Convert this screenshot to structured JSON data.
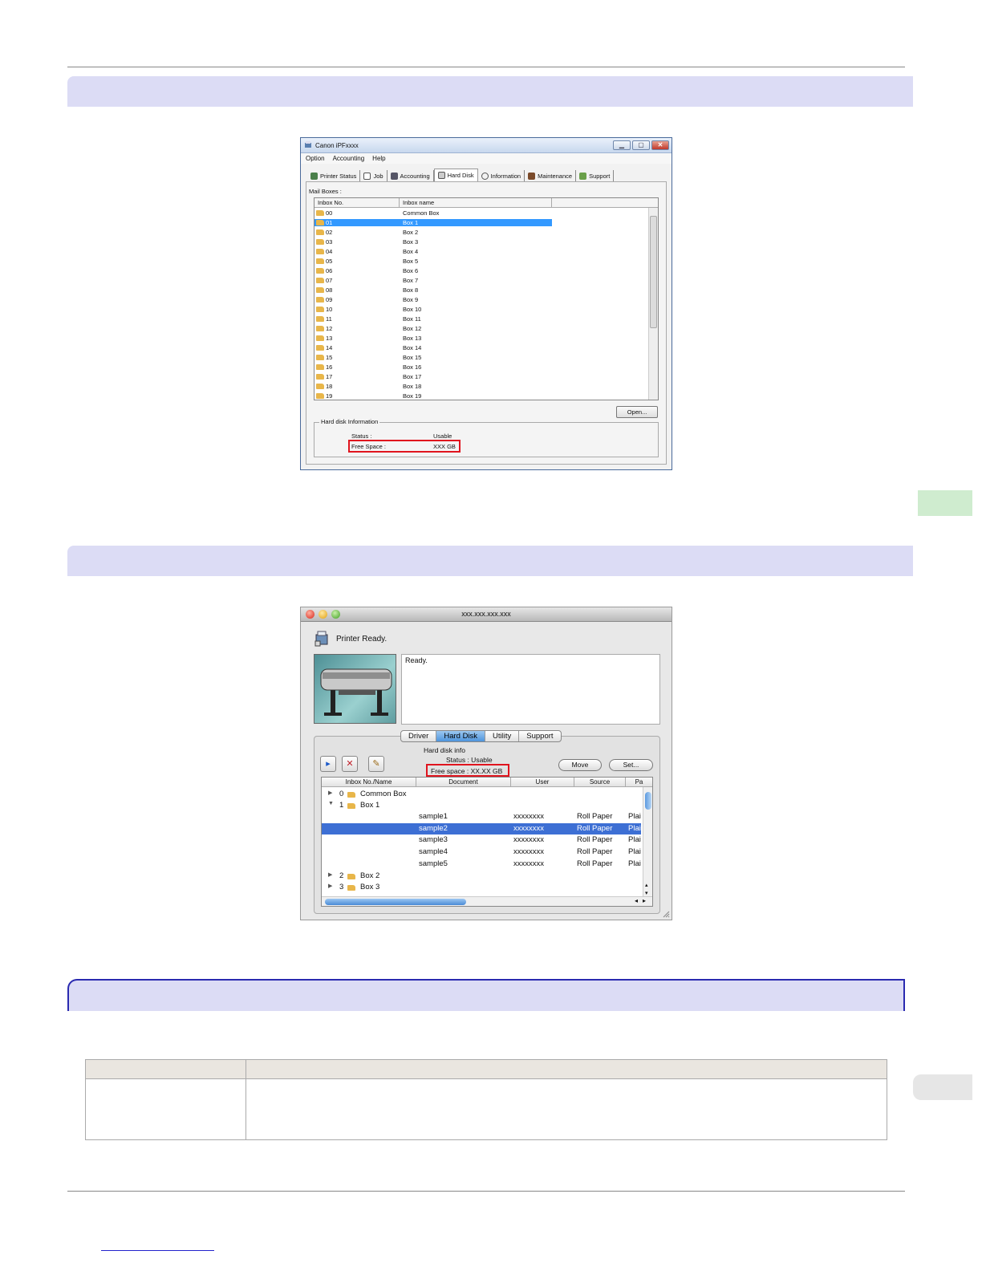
{
  "windows_dialog": {
    "title": "Canon iPFxxxx",
    "window_buttons": [
      "▁",
      "▢",
      "✕"
    ],
    "menu": [
      "Option",
      "Accounting",
      "Help"
    ],
    "tabs": [
      {
        "label": "Printer Status",
        "icon": "printer-icon",
        "active": false
      },
      {
        "label": "Job",
        "icon": "job-icon",
        "active": false
      },
      {
        "label": "Accounting",
        "icon": "accounting-icon",
        "active": false
      },
      {
        "label": "Hard Disk",
        "icon": "hard-disk-icon",
        "active": true
      },
      {
        "label": "Information",
        "icon": "info-icon",
        "active": false
      },
      {
        "label": "Maintenance",
        "icon": "maintenance-icon",
        "active": false
      },
      {
        "label": "Support",
        "icon": "support-icon",
        "active": false
      }
    ],
    "mailboxes_label": "Mail Boxes :",
    "columns": [
      "Inbox No.",
      "Inbox name"
    ],
    "rows": [
      {
        "no": "00",
        "name": "Common Box"
      },
      {
        "no": "01",
        "name": "Box 1"
      },
      {
        "no": "02",
        "name": "Box 2"
      },
      {
        "no": "03",
        "name": "Box 3"
      },
      {
        "no": "04",
        "name": "Box 4"
      },
      {
        "no": "05",
        "name": "Box 5"
      },
      {
        "no": "06",
        "name": "Box 6"
      },
      {
        "no": "07",
        "name": "Box 7"
      },
      {
        "no": "08",
        "name": "Box 8"
      },
      {
        "no": "09",
        "name": "Box 9"
      },
      {
        "no": "10",
        "name": "Box 10"
      },
      {
        "no": "11",
        "name": "Box 11"
      },
      {
        "no": "12",
        "name": "Box 12"
      },
      {
        "no": "13",
        "name": "Box 13"
      },
      {
        "no": "14",
        "name": "Box 14"
      },
      {
        "no": "15",
        "name": "Box 15"
      },
      {
        "no": "16",
        "name": "Box 16"
      },
      {
        "no": "17",
        "name": "Box 17"
      },
      {
        "no": "18",
        "name": "Box 18"
      },
      {
        "no": "19",
        "name": "Box 19"
      }
    ],
    "open_button": "Open...",
    "hd_group_label": "Hard disk Information",
    "status_label": "Status :",
    "status_value": "Usable",
    "free_label": "Free Space :",
    "free_value": "XXX GB"
  },
  "mac_dialog": {
    "title": "xxx.xxx.xxx.xxx",
    "header": "Printer Ready.",
    "ready_text": "Ready.",
    "tabs": [
      "Driver",
      "Hard Disk",
      "Utility",
      "Support"
    ],
    "active_tab": "Hard Disk",
    "hd_info_title": "Hard disk info",
    "status_line": "Status :  Usable",
    "free_line": "Free space :  XX.XX GB",
    "move_button": "Move",
    "set_button": "Set...",
    "columns": [
      "Inbox No./Name",
      "Document",
      "User",
      "Source",
      "Pa"
    ],
    "boxes": [
      {
        "no": "0",
        "name": "Common Box"
      },
      {
        "no": "1",
        "name": "Box 1"
      },
      {
        "no": "2",
        "name": "Box 2"
      },
      {
        "no": "3",
        "name": "Box 3"
      }
    ],
    "jobs": [
      {
        "doc": "sample1",
        "user": "xxxxxxxx",
        "source": "Roll Paper",
        "pa": "Plai"
      },
      {
        "doc": "sample2",
        "user": "xxxxxxxx",
        "source": "Roll Paper",
        "pa": "Plai"
      },
      {
        "doc": "sample3",
        "user": "xxxxxxxx",
        "source": "Roll Paper",
        "pa": "Plai"
      },
      {
        "doc": "sample4",
        "user": "xxxxxxxx",
        "source": "Roll Paper",
        "pa": "Plai"
      },
      {
        "doc": "sample5",
        "user": "xxxxxxxx",
        "source": "Roll Paper",
        "pa": "Plai"
      }
    ],
    "scroll_arrows": [
      "◂",
      "▸",
      "▴",
      "▾"
    ]
  }
}
